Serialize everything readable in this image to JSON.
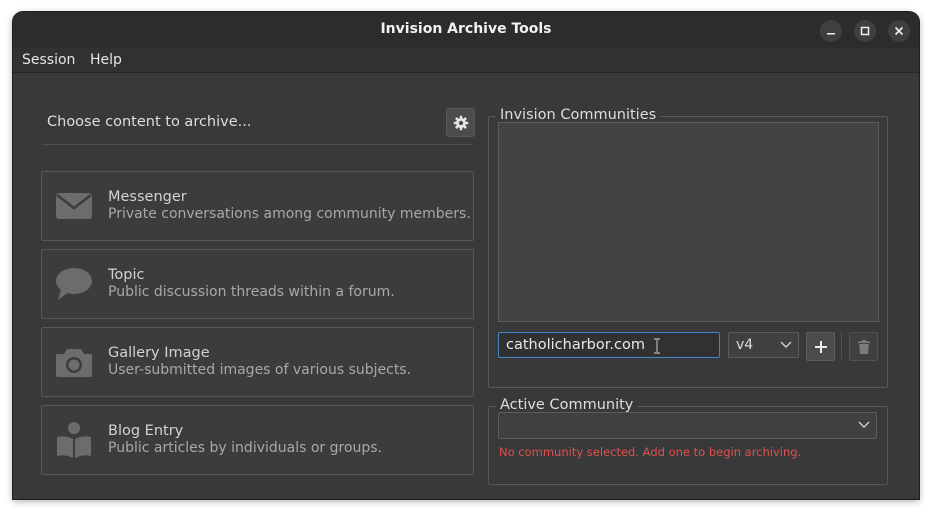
{
  "window": {
    "title": "Invision Archive Tools"
  },
  "menubar": {
    "items": [
      "Session",
      "Help"
    ]
  },
  "left_panel": {
    "choose_label": "Choose content to archive...",
    "settings_icon": "gear-icon",
    "cards": [
      {
        "title": "Messenger",
        "description": "Private conversations among community members.",
        "icon": "envelope-icon"
      },
      {
        "title": "Topic",
        "description": "Public discussion threads within a forum.",
        "icon": "speech-bubble-icon"
      },
      {
        "title": "Gallery Image",
        "description": "User-submitted images of various subjects.",
        "icon": "camera-icon"
      },
      {
        "title": "Blog Entry",
        "description": "Public articles by individuals or groups.",
        "icon": "reader-icon"
      }
    ]
  },
  "communities": {
    "group_label": "Invision Communities",
    "url_value": "catholicharbor.com",
    "version_value": "v4",
    "add_icon": "plus-icon",
    "delete_icon": "trash-icon"
  },
  "active_community": {
    "group_label": "Active Community",
    "selected_value": "",
    "error_message": "No community selected.  Add one to begin archiving."
  },
  "colors": {
    "window_bg": "#37393b",
    "titlebar_bg": "#2c2c2c",
    "accent_focus": "#3f88c5",
    "error": "#e2504a"
  }
}
